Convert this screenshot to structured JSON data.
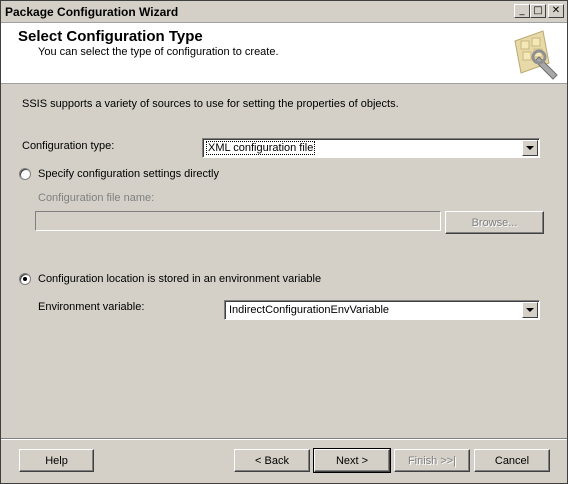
{
  "window": {
    "title": "Package Configuration Wizard",
    "controls": {
      "minimize": "_",
      "maximize": "□",
      "close": "✕"
    }
  },
  "header": {
    "title": "Select Configuration Type",
    "subtitle": "You can select the type of configuration to create.",
    "logo_icon": "wizard-logo-icon"
  },
  "intro": "SSIS supports a variety of sources to use for setting the properties of objects.",
  "config_type": {
    "label": "Configuration type:",
    "value": "XML configuration file"
  },
  "option_direct": {
    "label": "Specify configuration settings directly",
    "checked": false,
    "file_name_label": "Configuration file name:",
    "file_name_value": "",
    "browse_label": "Browse..."
  },
  "option_env": {
    "label": "Configuration location is stored in an environment variable",
    "checked": true,
    "env_label": "Environment variable:",
    "env_value": "IndirectConfigurationEnvVariable"
  },
  "footer": {
    "help": "Help",
    "back": "< Back",
    "next": "Next >",
    "finish": "Finish >>|",
    "cancel": "Cancel"
  }
}
